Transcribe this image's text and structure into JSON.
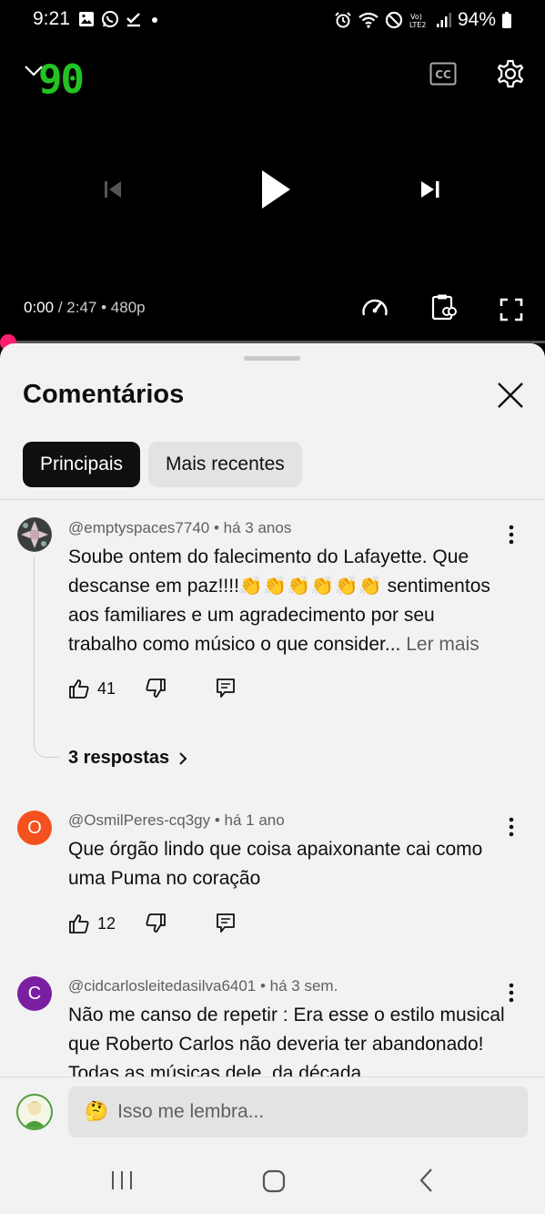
{
  "status_bar": {
    "time": "9:21",
    "battery": "94%"
  },
  "player": {
    "logo": "90",
    "current_time": "0:00",
    "duration": "/ 2:47",
    "quality": "• 480p",
    "progress_fraction": 0.0
  },
  "sheet": {
    "title": "Comentários",
    "chips": {
      "top": "Principais",
      "recent": "Mais recentes"
    }
  },
  "comments": [
    {
      "author": "@emptyspaces7740",
      "age": "há 3 anos",
      "text": "Soube ontem do falecimento do Lafayette.  Que descanse em paz!!!!👏👏👏👏👏👏 sentimentos aos familiares e um agradecimento por seu trabalho como músico o que consider...",
      "more": "Ler mais",
      "likes": "41",
      "replies": "3 respostas"
    },
    {
      "author": "@OsmilPeres-cq3gy",
      "age": "há 1 ano",
      "avatar_letter": "O",
      "avatar_color": "#f4511e",
      "text": "Que órgão lindo que coisa apaixonante cai como uma Puma no coração",
      "likes": "12"
    },
    {
      "author": "@cidcarlosleitedasilva6401",
      "age": "há 3 sem.",
      "avatar_letter": "C",
      "avatar_color": "#7b1fa2",
      "text": "Não me canso de repetir : Era esse o estilo musical que Roberto Carlos não deveria ter abandonado! Todas as músicas dele, da década"
    }
  ],
  "composer": {
    "emoji": "🤔",
    "placeholder": "Isso me lembra..."
  }
}
